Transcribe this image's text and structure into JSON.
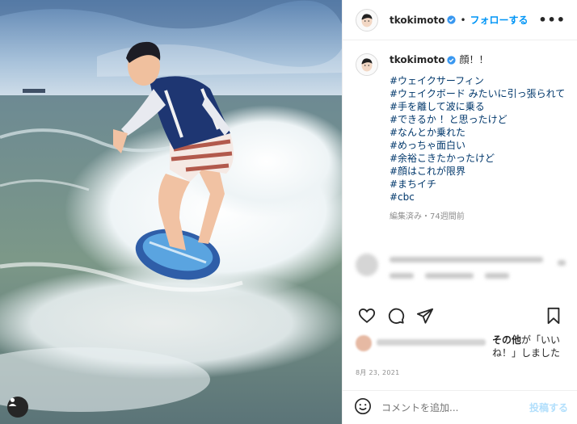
{
  "header": {
    "username": "tkokimoto",
    "separator": "•",
    "follow_label": "フォローする",
    "more_label": "•••"
  },
  "caption": {
    "username": "tkokimoto",
    "title": "顔！！",
    "lines": [
      "#ウェイクサーフィン",
      "#ウェイクボード みたいに引っ張られて",
      "#手を離して波に乗る",
      "#できるか ！と思ったけど",
      "#なんとか乗れた",
      "#めっちゃ面白い",
      "#余裕こきたかったけど",
      "#顔はこれが限界",
      "#まちイチ",
      "#cbc"
    ],
    "meta": "編集済み・74週間前"
  },
  "likes": {
    "and": "その他",
    "suffix": "が「いいね！」しました"
  },
  "date": "8月 23, 2021",
  "comment": {
    "placeholder": "コメントを追加...",
    "post_label": "投稿する"
  },
  "icons": {
    "verified": "verified-badge-icon",
    "more": "more-options-icon",
    "like": "heart-icon",
    "comment": "comment-bubble-icon",
    "share": "paper-plane-icon",
    "save": "bookmark-icon",
    "emoji": "emoji-icon",
    "tagged": "tagged-user-icon"
  },
  "colors": {
    "link": "#00376b",
    "accent": "#0095f6",
    "post_disabled": "#b2dffc",
    "muted": "#8e8e8e"
  }
}
